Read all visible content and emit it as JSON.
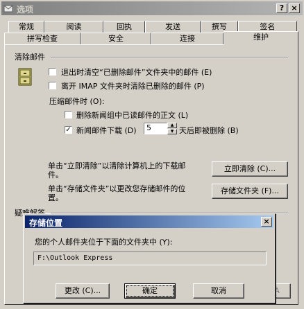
{
  "window": {
    "title": "选项",
    "help_btn": "?",
    "close_btn": "×"
  },
  "tabs_row1": [
    "常规",
    "阅读",
    "回执",
    "发送",
    "撰写",
    "签名"
  ],
  "tabs_row2": [
    "拼写检查",
    "安全",
    "连接",
    "维护"
  ],
  "active_tab": "维护",
  "clean": {
    "group_title": "清除邮件",
    "opt1": "退出时清空“已删除邮件”文件夹中的邮件 (E)",
    "opt2": "离开 IMAP 文件夹时清除已删除的邮件 (P)",
    "compact_label": "压缩邮件时 (O):",
    "opt3": "删除新闻组中已读邮件的正文 (L)",
    "opt4_pre": "新闻邮件下载 (D)",
    "opt4_days": "5",
    "opt4_post": "天后即被删除 (B)",
    "opt1_checked": false,
    "opt2_checked": false,
    "opt3_checked": false,
    "opt4_checked": true,
    "desc1": "单击“立即清除”以清除计算机上的下载邮件。",
    "btn_clean": "立即清除 (C)...",
    "desc2": "单击“存储文件夹”以更改您存储邮件的位置。",
    "btn_store": "存储文件夹 (F)..."
  },
  "trouble": {
    "group_title": "疑难解答"
  },
  "dialog": {
    "title": "存储位置",
    "close": "×",
    "label": "您的个人邮件夹位于下面的文件夹中 (Y):",
    "path": "F:\\Outlook Express",
    "btn_change": "更改 (C)...",
    "btn_ok": "确定",
    "btn_cancel": "取消"
  },
  "bg_apply": "A"
}
